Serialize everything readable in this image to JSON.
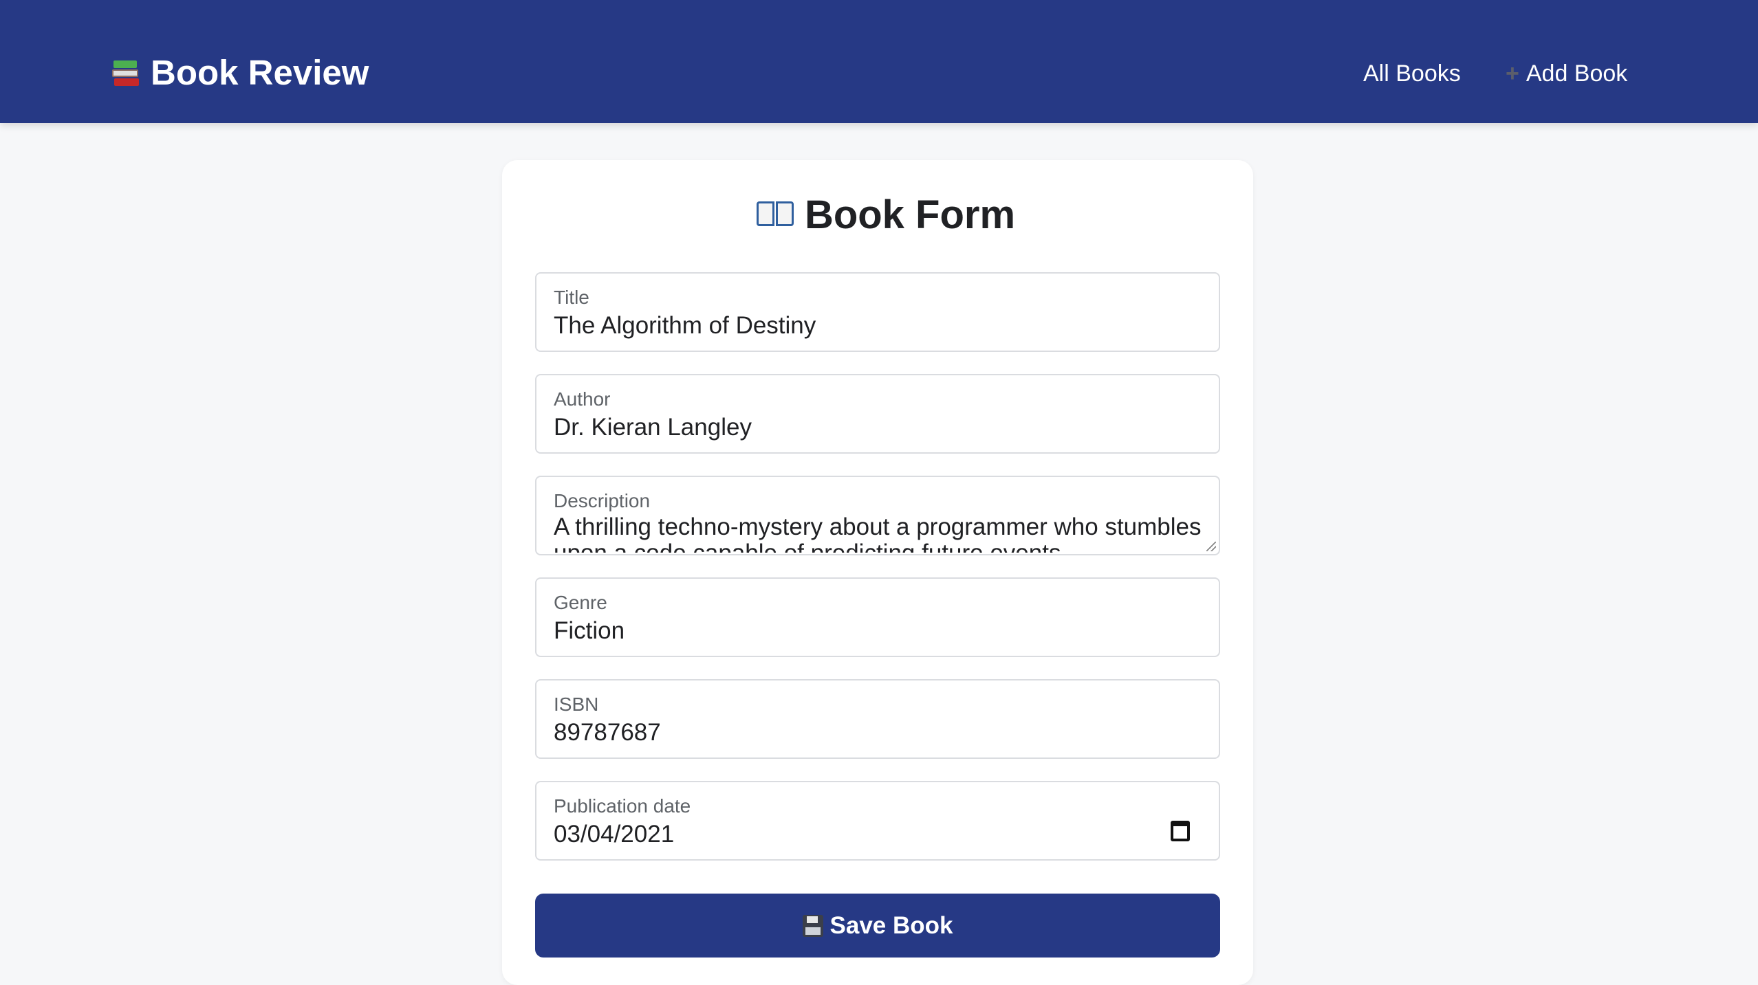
{
  "navbar": {
    "brand": "Book Review",
    "links": [
      {
        "label": "All Books"
      },
      {
        "label": "Add Book",
        "icon": "plus-icon"
      }
    ]
  },
  "form": {
    "title": "Book Form",
    "fields": {
      "title": {
        "label": "Title",
        "value": "The Algorithm of Destiny"
      },
      "author": {
        "label": "Author",
        "value": "Dr. Kieran Langley"
      },
      "description": {
        "label": "Description",
        "value": "A thrilling techno-mystery about a programmer who stumbles upon a code capable of predicting future events."
      },
      "genre": {
        "label": "Genre",
        "value": "Fiction"
      },
      "isbn": {
        "label": "ISBN",
        "value": "89787687"
      },
      "publication_date": {
        "label": "Publication date",
        "value": "03/04/2021"
      }
    },
    "submit_label": "Save Book"
  },
  "colors": {
    "primary": "#263985",
    "background": "#f6f7f9",
    "card": "#ffffff"
  }
}
